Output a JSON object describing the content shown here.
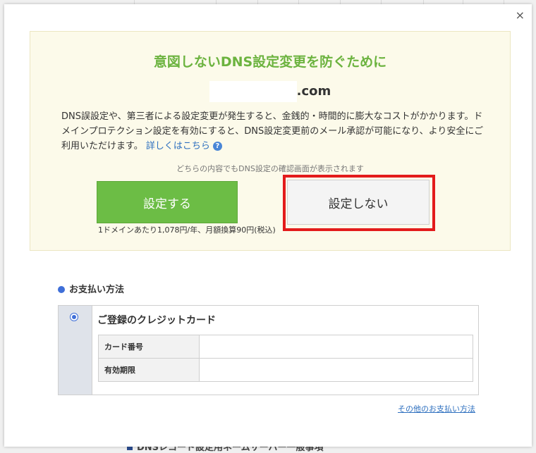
{
  "modal": {
    "close_glyph": "×",
    "notice": {
      "title": "意図しないDNS設定変更を防ぐために",
      "domain_suffix": ".com",
      "description": "DNS誤設定や、第三者による設定変更が発生すると、金銭的・時間的に膨大なコストがかかります。ドメインプロテクション設定を有効にすると、DNS設定変更前のメール承認が可能になり、より安全にご利用いただけます。",
      "details_link": "詳しくはこちら",
      "help_glyph": "?",
      "hint": "どちらの内容でもDNS設定の確認画面が表示されます",
      "enable_button": "設定する",
      "price_note": "1ドメインあたり1,078円/年、月額換算90円(税込)",
      "disable_button": "設定しない"
    },
    "payment": {
      "section_title": "お支払い方法",
      "card_option_title": "ご登録のクレジットカード",
      "rows": [
        {
          "label": "カード番号",
          "value": ""
        },
        {
          "label": "有効期限",
          "value": ""
        }
      ],
      "other_methods_link": "その他のお支払い方法"
    }
  },
  "background": {
    "partial_heading": "DNSレコード設定用ネームサーバー一般事項"
  },
  "colors": {
    "accent_green": "#6cbd45",
    "title_green": "#6cb33f",
    "highlight_red": "#e31b1b",
    "link_blue": "#2d6fbf"
  }
}
